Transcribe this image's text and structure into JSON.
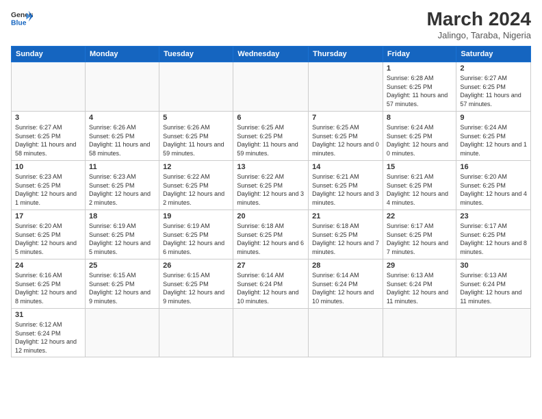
{
  "header": {
    "logo_general": "General",
    "logo_blue": "Blue",
    "month_year": "March 2024",
    "location": "Jalingo, Taraba, Nigeria"
  },
  "days_of_week": [
    "Sunday",
    "Monday",
    "Tuesday",
    "Wednesday",
    "Thursday",
    "Friday",
    "Saturday"
  ],
  "weeks": [
    [
      {
        "day": "",
        "info": ""
      },
      {
        "day": "",
        "info": ""
      },
      {
        "day": "",
        "info": ""
      },
      {
        "day": "",
        "info": ""
      },
      {
        "day": "",
        "info": ""
      },
      {
        "day": "1",
        "info": "Sunrise: 6:28 AM\nSunset: 6:25 PM\nDaylight: 11 hours\nand 57 minutes."
      },
      {
        "day": "2",
        "info": "Sunrise: 6:27 AM\nSunset: 6:25 PM\nDaylight: 11 hours\nand 57 minutes."
      }
    ],
    [
      {
        "day": "3",
        "info": "Sunrise: 6:27 AM\nSunset: 6:25 PM\nDaylight: 11 hours\nand 58 minutes."
      },
      {
        "day": "4",
        "info": "Sunrise: 6:26 AM\nSunset: 6:25 PM\nDaylight: 11 hours\nand 58 minutes."
      },
      {
        "day": "5",
        "info": "Sunrise: 6:26 AM\nSunset: 6:25 PM\nDaylight: 11 hours\nand 59 minutes."
      },
      {
        "day": "6",
        "info": "Sunrise: 6:25 AM\nSunset: 6:25 PM\nDaylight: 11 hours\nand 59 minutes."
      },
      {
        "day": "7",
        "info": "Sunrise: 6:25 AM\nSunset: 6:25 PM\nDaylight: 12 hours\nand 0 minutes."
      },
      {
        "day": "8",
        "info": "Sunrise: 6:24 AM\nSunset: 6:25 PM\nDaylight: 12 hours\nand 0 minutes."
      },
      {
        "day": "9",
        "info": "Sunrise: 6:24 AM\nSunset: 6:25 PM\nDaylight: 12 hours\nand 1 minute."
      }
    ],
    [
      {
        "day": "10",
        "info": "Sunrise: 6:23 AM\nSunset: 6:25 PM\nDaylight: 12 hours\nand 1 minute."
      },
      {
        "day": "11",
        "info": "Sunrise: 6:23 AM\nSunset: 6:25 PM\nDaylight: 12 hours\nand 2 minutes."
      },
      {
        "day": "12",
        "info": "Sunrise: 6:22 AM\nSunset: 6:25 PM\nDaylight: 12 hours\nand 2 minutes."
      },
      {
        "day": "13",
        "info": "Sunrise: 6:22 AM\nSunset: 6:25 PM\nDaylight: 12 hours\nand 3 minutes."
      },
      {
        "day": "14",
        "info": "Sunrise: 6:21 AM\nSunset: 6:25 PM\nDaylight: 12 hours\nand 3 minutes."
      },
      {
        "day": "15",
        "info": "Sunrise: 6:21 AM\nSunset: 6:25 PM\nDaylight: 12 hours\nand 4 minutes."
      },
      {
        "day": "16",
        "info": "Sunrise: 6:20 AM\nSunset: 6:25 PM\nDaylight: 12 hours\nand 4 minutes."
      }
    ],
    [
      {
        "day": "17",
        "info": "Sunrise: 6:20 AM\nSunset: 6:25 PM\nDaylight: 12 hours\nand 5 minutes."
      },
      {
        "day": "18",
        "info": "Sunrise: 6:19 AM\nSunset: 6:25 PM\nDaylight: 12 hours\nand 5 minutes."
      },
      {
        "day": "19",
        "info": "Sunrise: 6:19 AM\nSunset: 6:25 PM\nDaylight: 12 hours\nand 6 minutes."
      },
      {
        "day": "20",
        "info": "Sunrise: 6:18 AM\nSunset: 6:25 PM\nDaylight: 12 hours\nand 6 minutes."
      },
      {
        "day": "21",
        "info": "Sunrise: 6:18 AM\nSunset: 6:25 PM\nDaylight: 12 hours\nand 7 minutes."
      },
      {
        "day": "22",
        "info": "Sunrise: 6:17 AM\nSunset: 6:25 PM\nDaylight: 12 hours\nand 7 minutes."
      },
      {
        "day": "23",
        "info": "Sunrise: 6:17 AM\nSunset: 6:25 PM\nDaylight: 12 hours\nand 8 minutes."
      }
    ],
    [
      {
        "day": "24",
        "info": "Sunrise: 6:16 AM\nSunset: 6:25 PM\nDaylight: 12 hours\nand 8 minutes."
      },
      {
        "day": "25",
        "info": "Sunrise: 6:15 AM\nSunset: 6:25 PM\nDaylight: 12 hours\nand 9 minutes."
      },
      {
        "day": "26",
        "info": "Sunrise: 6:15 AM\nSunset: 6:25 PM\nDaylight: 12 hours\nand 9 minutes."
      },
      {
        "day": "27",
        "info": "Sunrise: 6:14 AM\nSunset: 6:24 PM\nDaylight: 12 hours\nand 10 minutes."
      },
      {
        "day": "28",
        "info": "Sunrise: 6:14 AM\nSunset: 6:24 PM\nDaylight: 12 hours\nand 10 minutes."
      },
      {
        "day": "29",
        "info": "Sunrise: 6:13 AM\nSunset: 6:24 PM\nDaylight: 12 hours\nand 11 minutes."
      },
      {
        "day": "30",
        "info": "Sunrise: 6:13 AM\nSunset: 6:24 PM\nDaylight: 12 hours\nand 11 minutes."
      }
    ],
    [
      {
        "day": "31",
        "info": "Sunrise: 6:12 AM\nSunset: 6:24 PM\nDaylight: 12 hours\nand 12 minutes."
      },
      {
        "day": "",
        "info": ""
      },
      {
        "day": "",
        "info": ""
      },
      {
        "day": "",
        "info": ""
      },
      {
        "day": "",
        "info": ""
      },
      {
        "day": "",
        "info": ""
      },
      {
        "day": "",
        "info": ""
      }
    ]
  ]
}
